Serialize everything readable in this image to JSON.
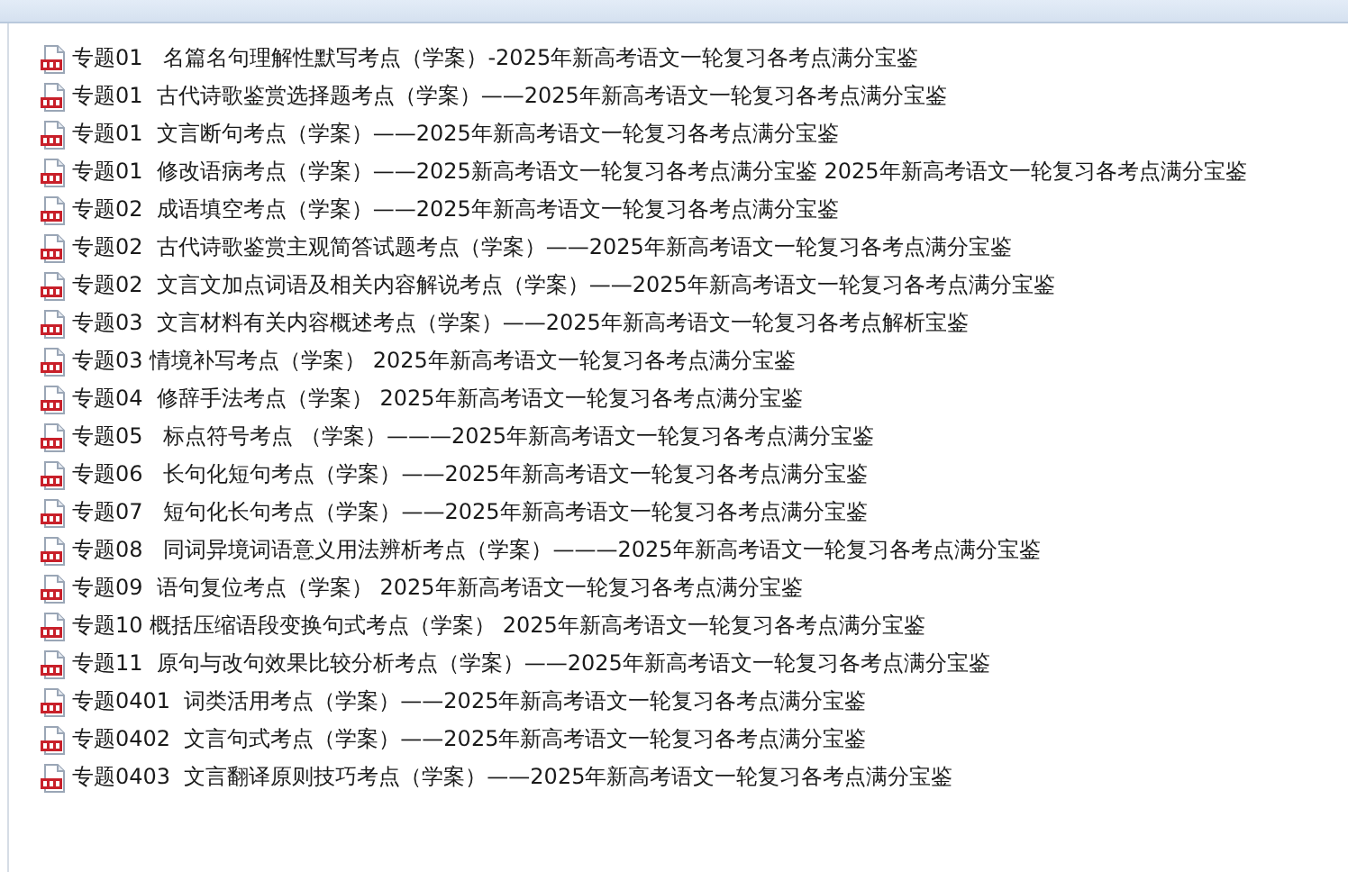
{
  "files": [
    {
      "name": "专题01   名篇名句理解性默写考点（学案）-2025年新高考语文一轮复习各考点满分宝鉴"
    },
    {
      "name": "专题01  古代诗歌鉴赏选择题考点（学案）——2025年新高考语文一轮复习各考点满分宝鉴"
    },
    {
      "name": "专题01  文言断句考点（学案）——2025年新高考语文一轮复习各考点满分宝鉴"
    },
    {
      "name": "专题01  修改语病考点（学案）——2025新高考语文一轮复习各考点满分宝鉴 2025年新高考语文一轮复习各考点满分宝鉴"
    },
    {
      "name": "专题02  成语填空考点（学案）——2025年新高考语文一轮复习各考点满分宝鉴"
    },
    {
      "name": "专题02  古代诗歌鉴赏主观简答试题考点（学案）——2025年新高考语文一轮复习各考点满分宝鉴"
    },
    {
      "name": "专题02  文言文加点词语及相关内容解说考点（学案）——2025年新高考语文一轮复习各考点满分宝鉴"
    },
    {
      "name": "专题03  文言材料有关内容概述考点（学案）——2025年新高考语文一轮复习各考点解析宝鉴"
    },
    {
      "name": "专题03 情境补写考点（学案） 2025年新高考语文一轮复习各考点满分宝鉴"
    },
    {
      "name": "专题04  修辞手法考点（学案） 2025年新高考语文一轮复习各考点满分宝鉴"
    },
    {
      "name": "专题05   标点符号考点 （学案）———2025年新高考语文一轮复习各考点满分宝鉴"
    },
    {
      "name": "专题06   长句化短句考点（学案）——2025年新高考语文一轮复习各考点满分宝鉴"
    },
    {
      "name": "专题07   短句化长句考点（学案）——2025年新高考语文一轮复习各考点满分宝鉴"
    },
    {
      "name": "专题08   同词异境词语意义用法辨析考点（学案）———2025年新高考语文一轮复习各考点满分宝鉴"
    },
    {
      "name": "专题09  语句复位考点（学案） 2025年新高考语文一轮复习各考点满分宝鉴"
    },
    {
      "name": "专题10 概括压缩语段变换句式考点（学案） 2025年新高考语文一轮复习各考点满分宝鉴"
    },
    {
      "name": "专题11  原句与改句效果比较分析考点（学案）——2025年新高考语文一轮复习各考点满分宝鉴"
    },
    {
      "name": "专题0401  词类活用考点（学案）——2025年新高考语文一轮复习各考点满分宝鉴"
    },
    {
      "name": "专题0402  文言句式考点（学案）——2025年新高考语文一轮复习各考点满分宝鉴"
    },
    {
      "name": "专题0403  文言翻译原则技巧考点（学案）——2025年新高考语文一轮复习各考点满分宝鉴"
    }
  ]
}
